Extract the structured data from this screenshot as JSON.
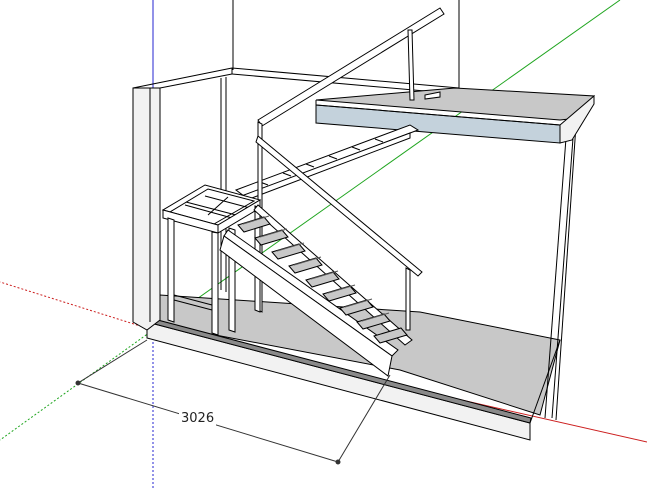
{
  "viewport": {
    "label": ""
  },
  "dimension": {
    "value": "3026",
    "unit": ""
  },
  "colors": {
    "background": "#ffffff",
    "axis_red": "#cc1f1f",
    "axis_green": "#1fa51f",
    "axis_blue": "#2525d0",
    "face_light": "#f2f2f2",
    "face_gray": "#c8c8c8",
    "face_dark": "#8a8a8a",
    "face_blue": "#c4d2dc",
    "edge": "#000000"
  },
  "model": {
    "description_components": [
      "room-walls",
      "floor-slab",
      "upper-landing",
      "staircase",
      "handrails",
      "lower-platform-frame"
    ]
  }
}
